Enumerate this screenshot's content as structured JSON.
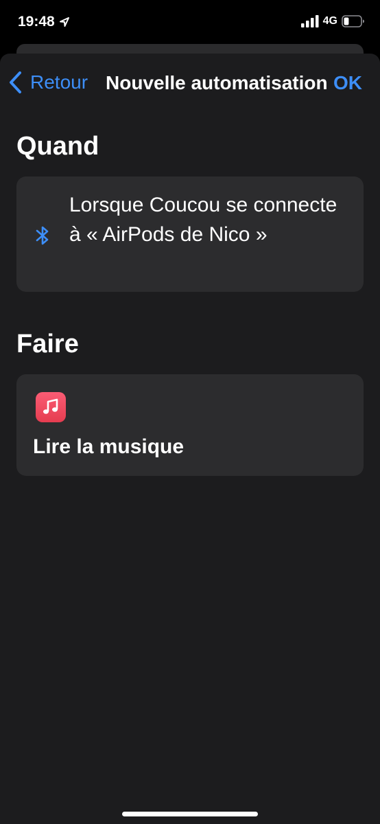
{
  "status_bar": {
    "time": "19:48",
    "network": "4G",
    "battery_level": 0.3
  },
  "nav": {
    "back_label": "Retour",
    "title": "Nouvelle automatisation",
    "ok_label": "OK"
  },
  "when_section": {
    "title": "Quand",
    "trigger_text": "Lorsque Coucou se connecte à « AirPods de Nico »",
    "icon": "bluetooth-icon"
  },
  "do_section": {
    "title": "Faire",
    "action_label": "Lire la musique",
    "icon": "music-app-icon"
  },
  "colors": {
    "accent": "#3d8ef7",
    "background": "#1c1c1e",
    "card": "#2c2c2e",
    "music_red": "#f0475c"
  }
}
